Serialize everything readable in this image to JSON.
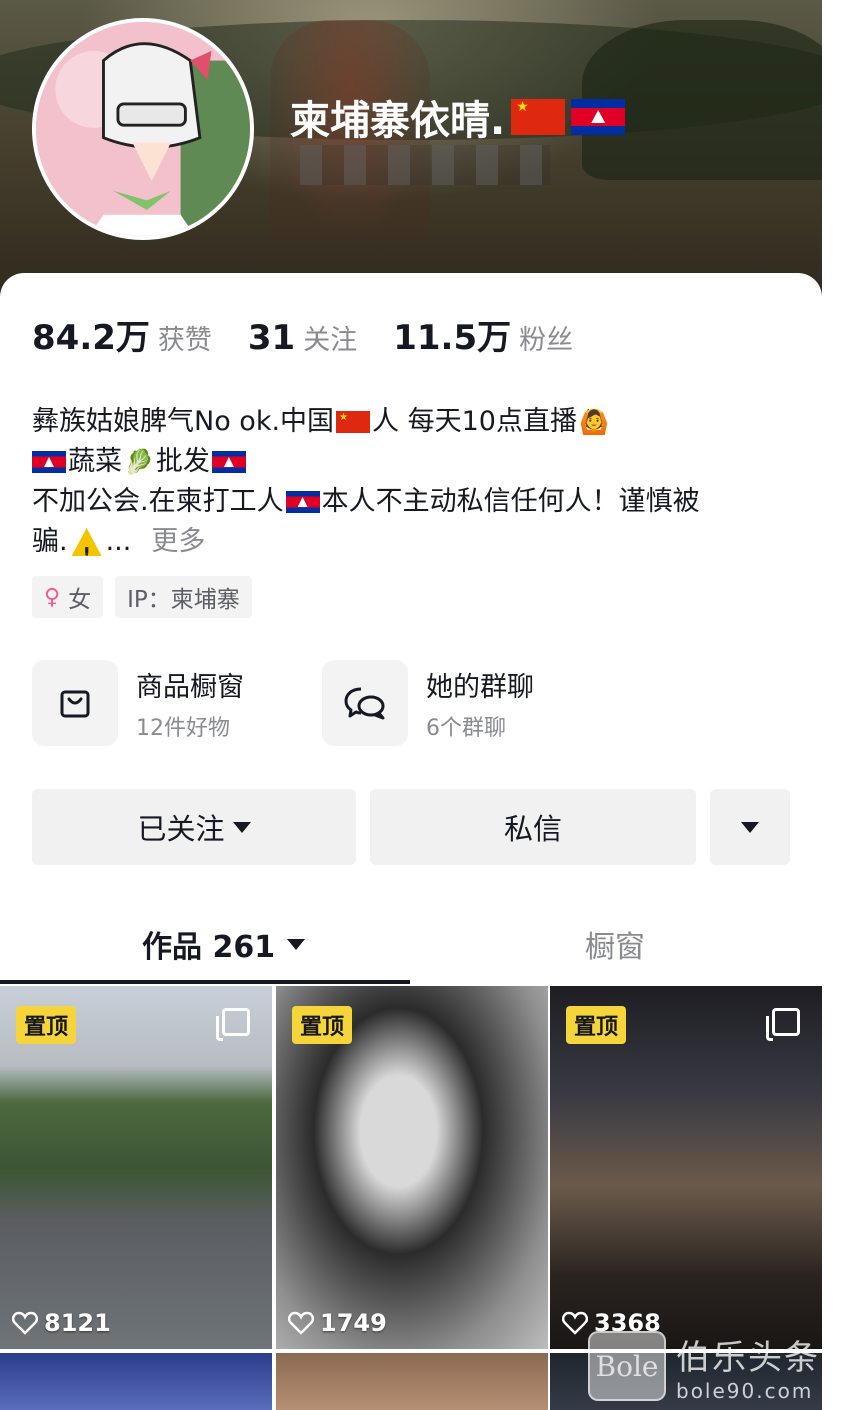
{
  "profile": {
    "username": "柬埔寨依晴.",
    "flags": [
      "cn-flag",
      "kh-flag"
    ]
  },
  "stats": [
    {
      "value": "84.2万",
      "label": "获赞"
    },
    {
      "value": "31",
      "label": "关注"
    },
    {
      "value": "11.5万",
      "label": "粉丝"
    }
  ],
  "bio": {
    "line1_a": "彝族姑娘脾气No ok.中国",
    "line1_b": "人 每天10点直播",
    "line2_a": "蔬菜",
    "line2_b": "批发",
    "line3_a": "不加公会.在柬打工人",
    "line3_b": "本人不主动私信任何人！谨慎被",
    "line4_a": "骗.",
    "line4_b": "...",
    "more": "更多"
  },
  "tags": {
    "gender": "女",
    "ip": "IP：柬埔寨"
  },
  "entries": {
    "shop": {
      "title": "商品橱窗",
      "sub": "12件好物"
    },
    "group": {
      "title": "她的群聊",
      "sub": "6个群聊"
    }
  },
  "actions": {
    "follow": "已关注",
    "message": "私信"
  },
  "tabs": {
    "works": "作品 261",
    "window": "橱窗"
  },
  "posts": [
    {
      "badge": "置顶",
      "likes": "8121"
    },
    {
      "badge": "置顶",
      "likes": "1749"
    },
    {
      "badge": "置顶",
      "likes": "3368"
    }
  ],
  "watermark": {
    "logo": "Bole",
    "cn": "伯乐头条",
    "url": "bole90.com"
  },
  "colors": {
    "accent_yellow": "#f6d53b",
    "text_primary": "#161823",
    "text_secondary": "#8a8b91",
    "button_bg": "#f1f1f2"
  }
}
